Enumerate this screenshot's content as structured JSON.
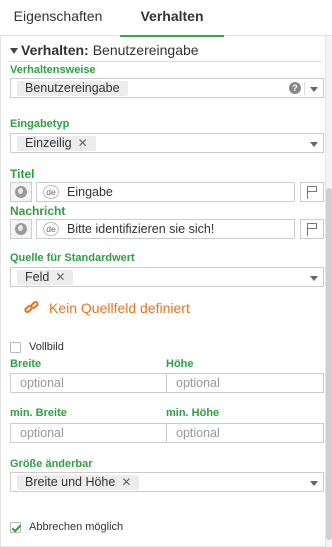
{
  "tabs": [
    {
      "label": "Eigenschaften"
    },
    {
      "label": "Verhalten"
    }
  ],
  "section": {
    "title_bold": "Verhalten:",
    "title_rest": "Benutzereingabe"
  },
  "fields": {
    "verhaltensweise": {
      "label": "Verhaltensweise",
      "value": "Benutzereingabe",
      "help": "?"
    },
    "eingabetyp": {
      "label": "Eingabetyp",
      "value": "Einzeilig",
      "remove": "✕"
    },
    "titel": {
      "label": "Titel",
      "lang": "de",
      "value": "Eingabe"
    },
    "nachricht": {
      "label": "Nachricht",
      "lang": "de",
      "value": "Bitte identifizieren sie sich!"
    },
    "quelle": {
      "label": "Quelle für Standardwert",
      "value": "Feld",
      "remove": "✕"
    },
    "warning": "Kein Quellfeld definiert",
    "vollbild": {
      "label": "Vollbild",
      "checked": false
    },
    "breite": {
      "label": "Breite",
      "placeholder": "optional"
    },
    "hoehe": {
      "label": "Höhe",
      "placeholder": "optional"
    },
    "min_breite": {
      "label": "min. Breite",
      "placeholder": "optional"
    },
    "min_hoehe": {
      "label": "min. Höhe",
      "placeholder": "optional"
    },
    "groesse": {
      "label": "Größe änderbar",
      "value": "Breite und Höhe",
      "remove": "✕"
    },
    "abbrechen": {
      "label": "Abbrechen möglich",
      "checked": true
    }
  },
  "colors": {
    "accent": "#2ea043",
    "warning": "#e8731f"
  }
}
